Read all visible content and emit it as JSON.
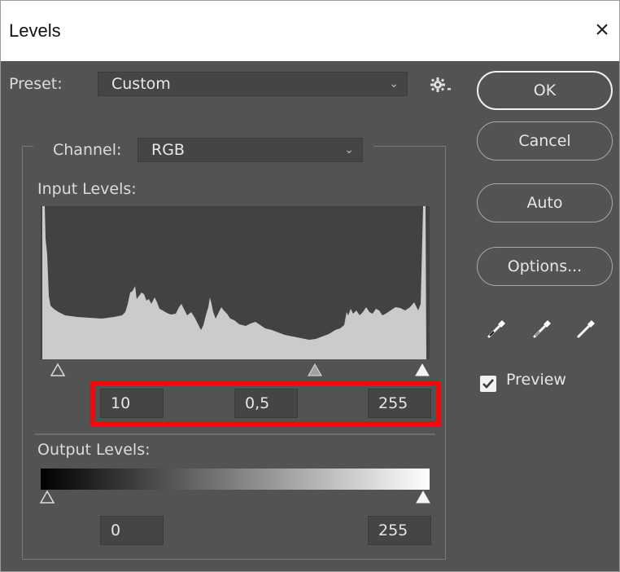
{
  "window": {
    "title": "Levels",
    "close_glyph": "×"
  },
  "preset": {
    "label": "Preset:",
    "value": "Custom",
    "chevron": "⌄",
    "menu_icon": "gear-icon"
  },
  "channel": {
    "label": "Channel:",
    "value": "RGB",
    "chevron": "⌄"
  },
  "input_levels": {
    "label": "Input Levels:",
    "black": "10",
    "gamma": "0,5",
    "white": "255"
  },
  "output_levels": {
    "label": "Output Levels:",
    "black": "0",
    "white": "255"
  },
  "buttons": {
    "ok": "OK",
    "cancel": "Cancel",
    "auto": "Auto",
    "options": "Options..."
  },
  "eyedroppers": [
    "black-point-eyedropper-icon",
    "gray-point-eyedropper-icon",
    "white-point-eyedropper-icon"
  ],
  "preview": {
    "label": "Preview",
    "checked": true
  },
  "colors": {
    "dialog_background": "#535353",
    "histogram_fill": "#cbcbcb",
    "highlight_border": "#ef0b0b"
  }
}
